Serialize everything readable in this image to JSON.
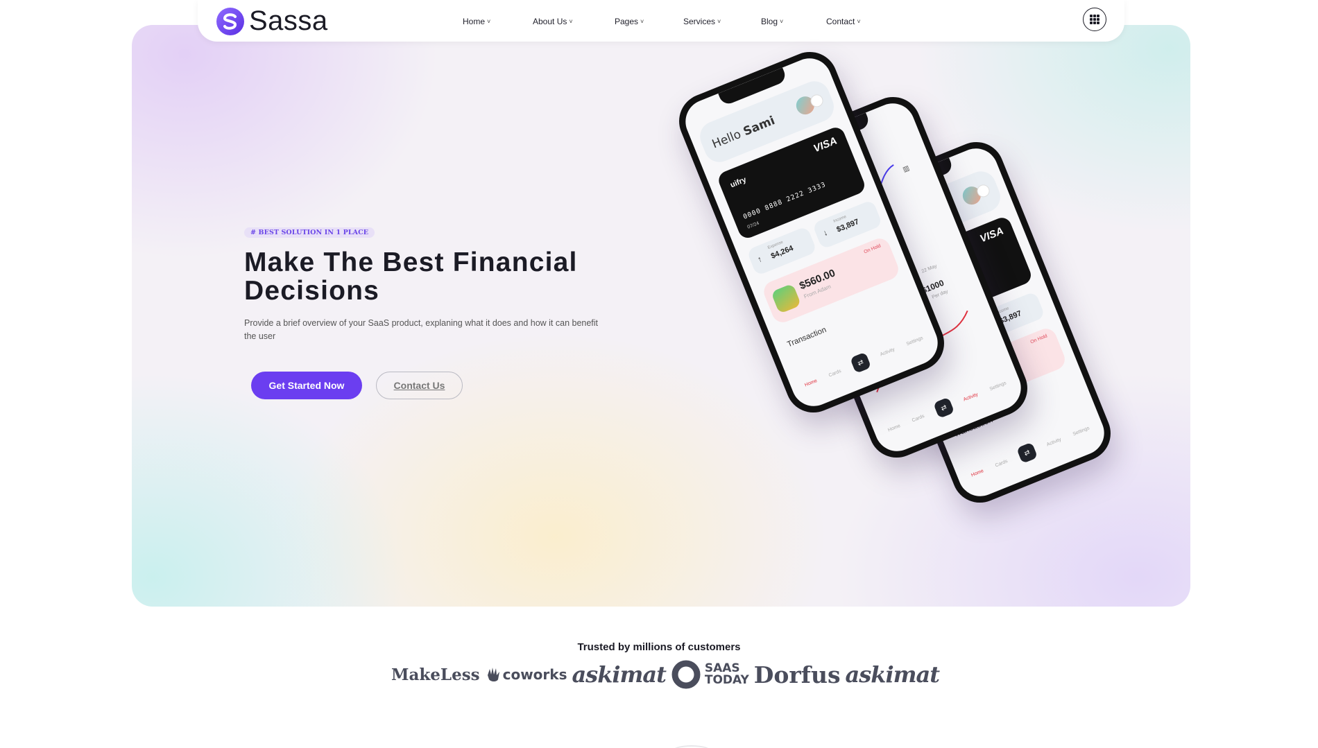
{
  "brand": {
    "name": "Sassa",
    "accent": "#6b3ef0"
  },
  "nav": {
    "items": [
      {
        "label": "Home"
      },
      {
        "label": "About Us"
      },
      {
        "label": "Pages"
      },
      {
        "label": "Services"
      },
      {
        "label": "Blog"
      },
      {
        "label": "Contact"
      }
    ],
    "chevron": "˅",
    "menu_icon": "grid-menu-icon"
  },
  "hero": {
    "badge": "# BEST SOLUTION IN 1 PLACE",
    "headline": "Make The Best Financial Decisions",
    "subtext": "Provide a brief overview of your SaaS product, explaning what it does and how it can benefit the user",
    "primary_button": "Get Started Now",
    "secondary_button": "Contact Us"
  },
  "phone": {
    "greeting": "Hello",
    "user": "Sami",
    "card_brand": "uifry",
    "card_network": "VISA",
    "card_number": "0000 8888 2222 3333",
    "card_expiry": "07/24",
    "expense_label": "Expense",
    "expense_value": "$4,264",
    "income_label": "Income",
    "income_value": "$3,897",
    "payment_amount": "$560.00",
    "payment_from": "From Adam",
    "payment_status": "On Hold",
    "transaction_label": "Transaction",
    "tabs": [
      "Home",
      "Cards",
      "⇄",
      "Activity",
      "Settings"
    ],
    "chart_date": "22 May",
    "chart_amount": "$1000",
    "chart_period": "Per day"
  },
  "trusted": {
    "title": "Trusted by millions of customers",
    "logos": [
      "MakeLess",
      "coworks",
      "askimat",
      "SAAS",
      "TODAY",
      "Dorfus",
      "askimat"
    ]
  }
}
